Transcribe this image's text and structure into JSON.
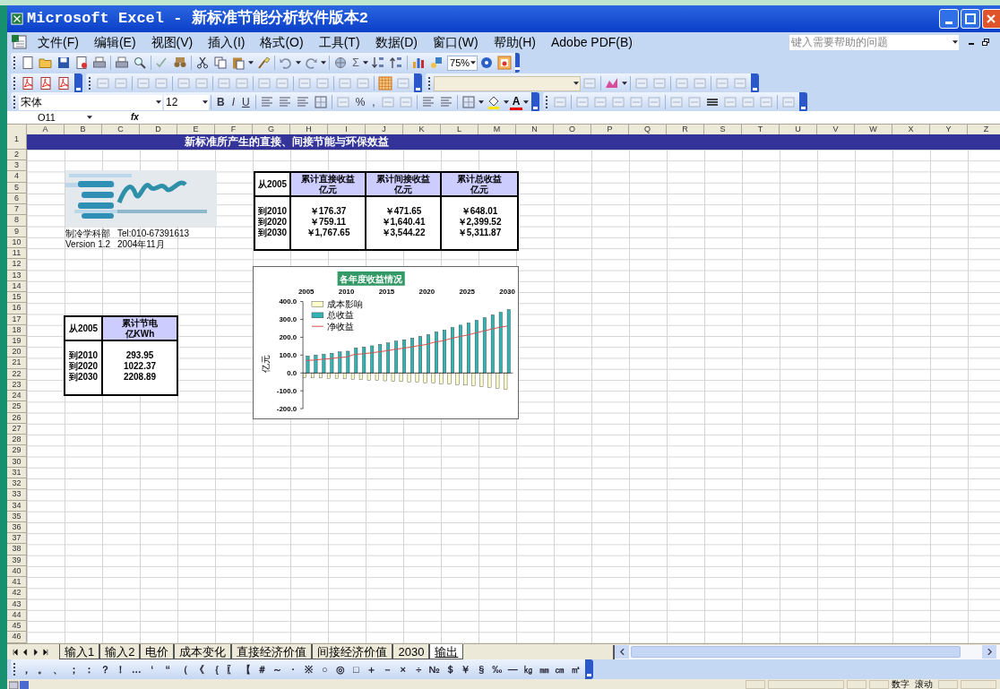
{
  "window": {
    "title": "Microsoft Excel - 新标准节能分析软件版本2"
  },
  "menu": [
    "文件(F)",
    "编辑(E)",
    "视图(V)",
    "插入(I)",
    "格式(O)",
    "工具(T)",
    "数据(D)",
    "窗口(W)",
    "帮助(H)",
    "Adobe PDF(B)"
  ],
  "help_search": {
    "placeholder": "键入需要帮助的问题"
  },
  "toolbars": {
    "sum": "Σ",
    "zoom": "75%",
    "font": "宋体",
    "font_size": "12",
    "format_buttons": [
      "B",
      "I",
      "U"
    ],
    "percent": "%",
    "comma": ",",
    "font_color": "A"
  },
  "formula_bar": {
    "name_box": "O11",
    "function_label": "fx"
  },
  "sheet": {
    "columns": [
      "A",
      "B",
      "C",
      "D",
      "E",
      "F",
      "G",
      "H",
      "I",
      "J",
      "K",
      "L",
      "M",
      "N",
      "O",
      "P",
      "Q",
      "R",
      "S",
      "T",
      "U",
      "V",
      "W",
      "X",
      "Y",
      "Z"
    ],
    "rows": [
      "1",
      "2",
      "3",
      "4",
      "5",
      "6",
      "7",
      "8",
      "9",
      "10",
      "11",
      "12",
      "13",
      "14",
      "15",
      "16",
      "17",
      "18",
      "19",
      "20",
      "21",
      "22",
      "23",
      "24",
      "25",
      "26",
      "27",
      "28",
      "29",
      "30",
      "31",
      "32",
      "33",
      "34",
      "35",
      "36",
      "37",
      "38",
      "39",
      "40",
      "41",
      "42",
      "43",
      "44",
      "45",
      "46"
    ],
    "title_band": "新标准所产生的直接、间接节能与环保效益",
    "logo": {
      "kind": "picture"
    },
    "caption": [
      [
        "制冷学科部",
        "Tel:010-67391613"
      ],
      [
        "Version 1.2",
        "2004年11月"
      ]
    ],
    "revenue_table": {
      "corner": "从2005",
      "headers": [
        [
          "累计直接收益",
          "亿元"
        ],
        [
          "累计间接收益",
          "亿元"
        ],
        [
          "累计总收益",
          "亿元"
        ]
      ],
      "rows": [
        {
          "label": "到2010",
          "values": [
            "￥176.37",
            "￥471.65",
            "￥648.01"
          ]
        },
        {
          "label": "到2020",
          "values": [
            "￥759.11",
            "￥1,640.41",
            "￥2,399.52"
          ]
        },
        {
          "label": "到2030",
          "values": [
            "￥1,767.65",
            "￥3,544.22",
            "￥5,311.87"
          ]
        }
      ]
    },
    "power_table": {
      "corner": "从2005",
      "headers": [
        [
          "累计节电",
          "亿KWh"
        ]
      ],
      "rows": [
        {
          "label": "到2010",
          "values": [
            "293.95"
          ]
        },
        {
          "label": "到2020",
          "values": [
            "1022.37"
          ]
        },
        {
          "label": "到2030",
          "values": [
            "2208.89"
          ]
        }
      ]
    },
    "chart_data": {
      "type": "bar",
      "title": "各年度收益情况",
      "ylabel": "亿元",
      "x": [
        2005,
        2006,
        2007,
        2008,
        2009,
        2010,
        2011,
        2012,
        2013,
        2014,
        2015,
        2016,
        2017,
        2018,
        2019,
        2020,
        2021,
        2022,
        2023,
        2024,
        2025,
        2026,
        2027,
        2028,
        2029,
        2030
      ],
      "xticks": [
        2005,
        2010,
        2015,
        2020,
        2025,
        2030
      ],
      "xlim": [
        2004.6,
        2030.7
      ],
      "legend": true,
      "ylim": [
        -200,
        400
      ],
      "yticks": [
        {
          "value": 400,
          "label": "400.0"
        },
        {
          "value": 300,
          "label": "300.0"
        },
        {
          "value": 200,
          "label": "200.0"
        },
        {
          "value": 100,
          "label": "100.0"
        },
        {
          "value": 0,
          "label": "0.0"
        },
        {
          "value": -100,
          "label": "-100.0"
        },
        {
          "value": -200,
          "label": "-200.0"
        }
      ],
      "series": [
        {
          "name": "成本影响",
          "type": "bar",
          "color": "#ffffcc",
          "values": [
            -25,
            -28,
            -28,
            -30,
            -32,
            -33,
            -36,
            -38,
            -40,
            -42,
            -44,
            -46,
            -48,
            -50,
            -52,
            -55,
            -57,
            -60,
            -62,
            -65,
            -68,
            -72,
            -76,
            -80,
            -85,
            -92
          ]
        },
        {
          "name": "总收益",
          "type": "bar",
          "color": "#33b3b3",
          "values": [
            95,
            100,
            105,
            110,
            118,
            122,
            140,
            145,
            152,
            160,
            168,
            178,
            186,
            195,
            205,
            215,
            230,
            240,
            255,
            268,
            280,
            295,
            310,
            325,
            340,
            355
          ]
        },
        {
          "name": "净收益",
          "type": "line",
          "color": "#d94c4c",
          "values": [
            70,
            72,
            77,
            80,
            86,
            89,
            104,
            107,
            112,
            118,
            124,
            132,
            138,
            145,
            153,
            160,
            173,
            180,
            193,
            203,
            212,
            223,
            234,
            245,
            255,
            263
          ]
        }
      ]
    }
  },
  "sheet_tabs": [
    {
      "label": "输入1",
      "selected": false
    },
    {
      "label": "输入2",
      "selected": false
    },
    {
      "label": "电价",
      "selected": false
    },
    {
      "label": "成本变化",
      "selected": false
    },
    {
      "label": "直接经济价值",
      "selected": false
    },
    {
      "label": "间接经济价值",
      "selected": false
    },
    {
      "label": "2030",
      "selected": false
    },
    {
      "label": "输出",
      "selected": true
    }
  ],
  "symbols": [
    "，",
    "。",
    "、",
    "；",
    "：",
    "？",
    "！",
    "…",
    "‘",
    "“",
    "（",
    "《",
    "｛",
    "〖",
    "【",
    "＃",
    "～",
    "·",
    "※",
    "○",
    "◎",
    "□",
    "＋",
    "－",
    "×",
    "÷",
    "№",
    "＄",
    "￥",
    "§",
    "‰",
    "—",
    "㎏",
    "㎜",
    "㎝",
    "㎡"
  ],
  "status_bar": {
    "indicators": [
      "数字",
      "滚动"
    ]
  }
}
